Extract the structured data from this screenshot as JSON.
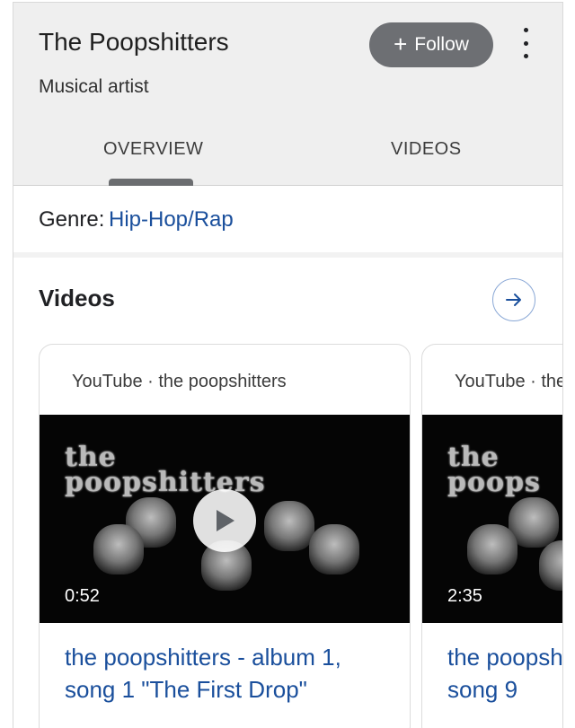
{
  "header": {
    "title": "The Poopshitters",
    "subtitle": "Musical artist",
    "follow_label": "Follow",
    "follow_icon": "plus-icon",
    "more_icon": "more-vertical-icon"
  },
  "tabs": [
    {
      "label": "OVERVIEW",
      "selected": true
    },
    {
      "label": "VIDEOS",
      "selected": false
    }
  ],
  "genre": {
    "label": "Genre:",
    "value": "Hip-Hop/Rap"
  },
  "videos": {
    "heading": "Videos",
    "arrow_icon": "arrow-right-icon",
    "cards": [
      {
        "source": "YouTube · the poopshitters",
        "thumb_line1": "the",
        "thumb_line2": "poopshitters",
        "duration": "0:52",
        "title": "the poopshitters - album 1, song 1 \"The First Drop\""
      },
      {
        "source": "YouTube · the p",
        "thumb_line1": "the",
        "thumb_line2": "poops",
        "duration": "2:35",
        "title": "the poopsh\nsong 9"
      }
    ]
  },
  "colors": {
    "link": "#1a4f9c",
    "follow_bg": "#6d6f73",
    "header_bg": "#efefef"
  }
}
